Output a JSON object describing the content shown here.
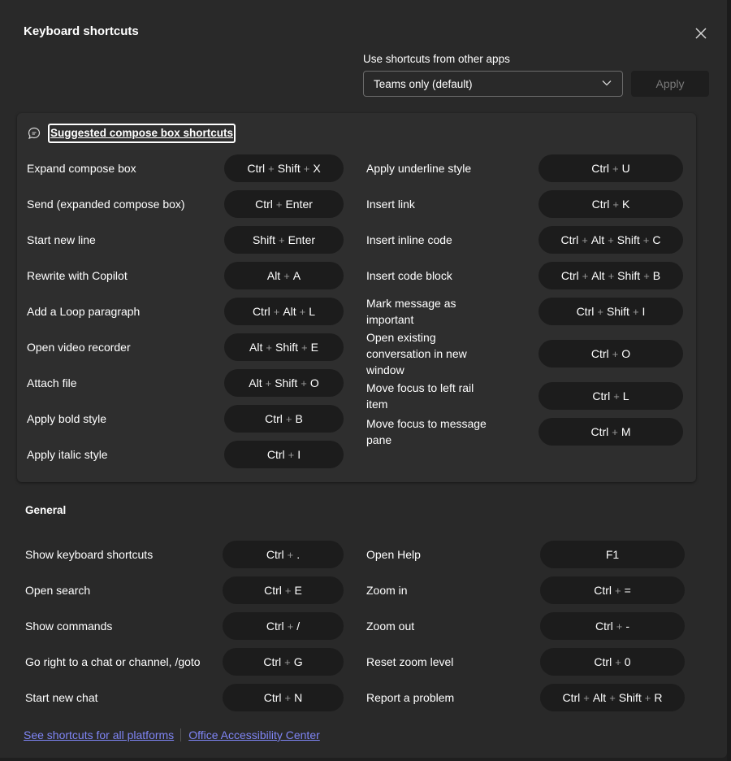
{
  "dialog": {
    "title": "Keyboard shortcuts",
    "other_apps_label": "Use shortcuts from other apps",
    "other_apps_value": "Teams only (default)",
    "apply_label": "Apply"
  },
  "compose": {
    "title": "Suggested compose box shortcuts",
    "left": [
      {
        "label": "Expand compose box",
        "keys": [
          "Ctrl",
          "Shift",
          "X"
        ]
      },
      {
        "label": "Send (expanded compose box)",
        "keys": [
          "Ctrl",
          "Enter"
        ]
      },
      {
        "label": "Start new line",
        "keys": [
          "Shift",
          "Enter"
        ]
      },
      {
        "label": "Rewrite with Copilot",
        "keys": [
          "Alt",
          "A"
        ]
      },
      {
        "label": "Add a Loop paragraph",
        "keys": [
          "Ctrl",
          "Alt",
          "L"
        ]
      },
      {
        "label": "Open video recorder",
        "keys": [
          "Alt",
          "Shift",
          "E"
        ]
      },
      {
        "label": "Attach file",
        "keys": [
          "Alt",
          "Shift",
          "O"
        ]
      },
      {
        "label": "Apply bold style",
        "keys": [
          "Ctrl",
          "B"
        ]
      },
      {
        "label": "Apply italic style",
        "keys": [
          "Ctrl",
          "I"
        ]
      }
    ],
    "right": [
      {
        "label": "Apply underline style",
        "keys": [
          "Ctrl",
          "U"
        ]
      },
      {
        "label": "Insert link",
        "keys": [
          "Ctrl",
          "K"
        ]
      },
      {
        "label": "Insert inline code",
        "keys": [
          "Ctrl",
          "Alt",
          "Shift",
          "C"
        ]
      },
      {
        "label": "Insert code block",
        "keys": [
          "Ctrl",
          "Alt",
          "Shift",
          "B"
        ]
      },
      {
        "label": "Mark message as important",
        "keys": [
          "Ctrl",
          "Shift",
          "I"
        ]
      },
      {
        "label": "Open existing conversation in new window",
        "keys": [
          "Ctrl",
          "O"
        ]
      },
      {
        "label": "Move focus to left rail item",
        "keys": [
          "Ctrl",
          "L"
        ]
      },
      {
        "label": "Move focus to message pane",
        "keys": [
          "Ctrl",
          "M"
        ]
      }
    ]
  },
  "general": {
    "title": "General",
    "left": [
      {
        "label": "Show keyboard shortcuts",
        "keys": [
          "Ctrl",
          "."
        ]
      },
      {
        "label": "Open search",
        "keys": [
          "Ctrl",
          "E"
        ]
      },
      {
        "label": "Show commands",
        "keys": [
          "Ctrl",
          "/"
        ]
      },
      {
        "label": "Go right to a chat or channel, /goto",
        "keys": [
          "Ctrl",
          "G"
        ]
      },
      {
        "label": "Start new chat",
        "keys": [
          "Ctrl",
          "N"
        ]
      }
    ],
    "right": [
      {
        "label": "Open Help",
        "keys": [
          "F1"
        ]
      },
      {
        "label": "Zoom in",
        "keys": [
          "Ctrl",
          "="
        ]
      },
      {
        "label": "Zoom out",
        "keys": [
          "Ctrl",
          "-"
        ]
      },
      {
        "label": "Reset zoom level",
        "keys": [
          "Ctrl",
          "0"
        ]
      },
      {
        "label": "Report a problem",
        "keys": [
          "Ctrl",
          "Alt",
          "Shift",
          "R"
        ]
      }
    ]
  },
  "footer": {
    "link1": "See shortcuts for all platforms",
    "link2": "Office Accessibility Center"
  },
  "icons": {
    "close": "close-icon",
    "chevron": "chevron-down-icon",
    "chat": "chat-bubble-icon"
  },
  "colors": {
    "background": "#292929",
    "key_pill": "#1c1c1c",
    "link": "#7f85f5"
  }
}
